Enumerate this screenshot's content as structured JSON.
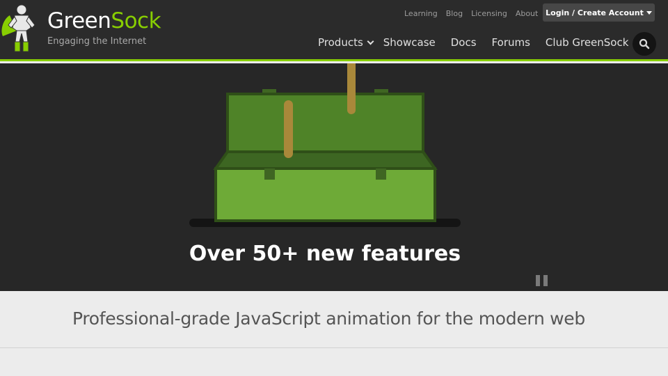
{
  "colors": {
    "brand_green": "#88ce02",
    "header_bg": "#2b2b2b",
    "hero_bg": "#272727",
    "subhead_bg": "#ececec"
  },
  "header": {
    "logo": {
      "brand_part1": "Green",
      "brand_part2": "Sock",
      "tagline": "Engaging the Internet"
    },
    "utility_nav": [
      "Learning",
      "Blog",
      "Licensing",
      "About"
    ],
    "login_label": "Login / Create Account",
    "main_nav": {
      "products": "Products",
      "showcase": "Showcase",
      "docs": "Docs",
      "forums": "Forums",
      "club": "Club GreenSock"
    },
    "search_icon": "search-icon"
  },
  "hero": {
    "caption": "Over 50+ new features",
    "pause_icon": "pause-icon"
  },
  "subhead": {
    "text": "Professional-grade JavaScript animation for the modern web"
  }
}
